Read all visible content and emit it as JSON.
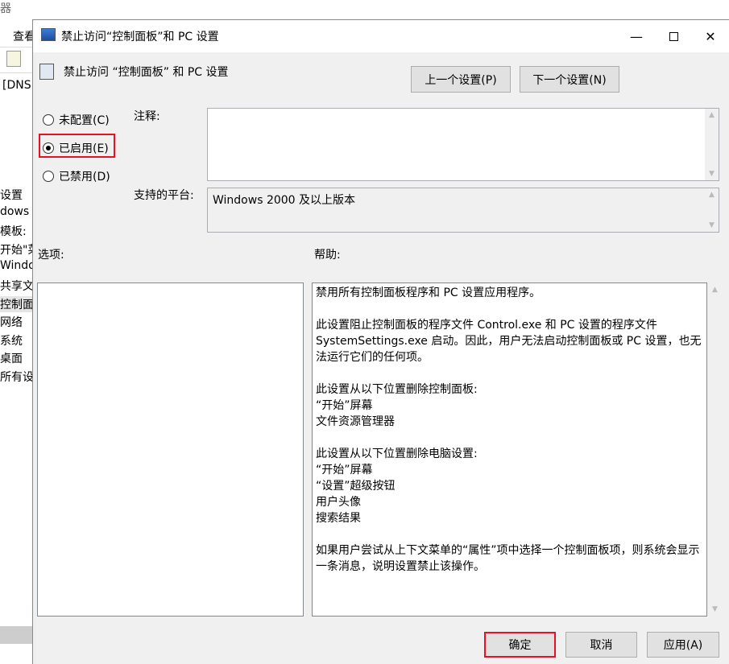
{
  "background": {
    "title_fragment": "器",
    "menu_fragment": "查看",
    "path_fragment": "[DNS",
    "items": [
      "设置",
      "dows i",
      "模板: ",
      "开始\"菜",
      "Windo",
      "共享文",
      "控制面",
      "网络",
      "系统",
      "桌面",
      "所有设"
    ]
  },
  "dialog": {
    "title": "禁止访问“控制面板”和 PC 设置",
    "header": "禁止访问 “控制面板” 和 PC 设置",
    "prev_button": "上一个设置(P)",
    "next_button": "下一个设置(N)",
    "radios": [
      {
        "label": "未配置(C)",
        "checked": false
      },
      {
        "label": "已启用(E)",
        "checked": true
      },
      {
        "label": "已禁用(D)",
        "checked": false
      }
    ],
    "comment_label": "注释:",
    "comment_value": "",
    "platform_label": "支持的平台:",
    "platform_value": "Windows 2000 及以上版本",
    "options_label": "选项:",
    "help_label": "帮助:",
    "help_paragraphs": [
      [
        "禁用所有控制面板程序和 PC 设置应用程序。"
      ],
      [
        "此设置阻止控制面板的程序文件 Control.exe 和 PC 设置的程序文件 SystemSettings.exe 启动。因此，用户无法启动控制面板或 PC 设置，也无法运行它们的任何项。"
      ],
      [
        "此设置从以下位置删除控制面板:",
        "“开始”屏幕",
        "文件资源管理器"
      ],
      [
        "此设置从以下位置删除电脑设置:",
        "“开始”屏幕",
        "“设置”超级按钮",
        "用户头像",
        "搜索结果"
      ],
      [
        "如果用户尝试从上下文菜单的“属性”项中选择一个控制面板项，则系统会显示一条消息，说明设置禁止该操作。"
      ]
    ],
    "ok_button": "确定",
    "cancel_button": "取消",
    "apply_button": "应用(A)"
  },
  "colors": {
    "highlight": "#e81123"
  }
}
